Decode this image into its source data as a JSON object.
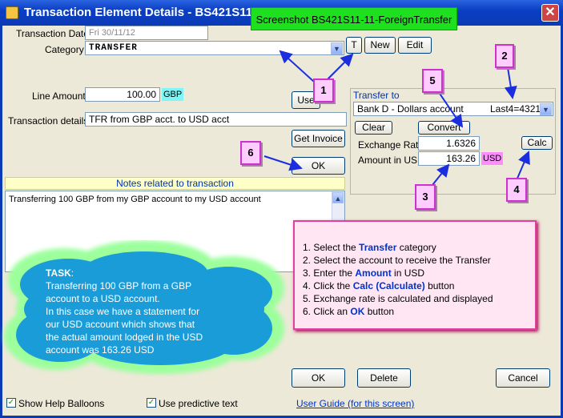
{
  "window": {
    "title": "Transaction Element Details - BS421S11",
    "close_glyph": "✕"
  },
  "screenshot_tag": "Screenshot BS421S11-11-ForeignTransfer",
  "form": {
    "transaction_date_label": "Transaction Date",
    "transaction_date_value": "Fri 30/11/12",
    "category_label": "Category",
    "category_value": "TRANSFER",
    "t_button": "T",
    "new_button": "New",
    "edit_button": "Edit",
    "line_amount_label": "Line Amount",
    "line_amount_value": "100.00",
    "line_amount_currency": "GBP",
    "use_button": "Use",
    "transaction_details_label": "Transaction details",
    "transaction_details_value": "TFR from GBP acct. to USD acct",
    "get_invoice_button": "Get Invoice",
    "ok_button_top": "OK"
  },
  "transfer_panel": {
    "title": "Transfer to",
    "account_value": "Bank D - Dollars account",
    "account_last4": "Last4=4321",
    "clear_button": "Clear",
    "convert_button": "Convert",
    "exchange_rate_label": "Exchange Rate",
    "exchange_rate_value": "1.6326",
    "amount_usd_label": "Amount in USD",
    "amount_usd_value": "163.26",
    "amount_usd_currency": "USD",
    "calc_button": "Calc"
  },
  "notes": {
    "header": "Notes related to transaction",
    "content": "Transferring 100 GBP from my GBP account to my USD account"
  },
  "callouts": [
    "1",
    "2",
    "3",
    "4",
    "5",
    "6"
  ],
  "instructions": [
    {
      "prefix": "1. Select the ",
      "kw": "Transfer",
      "suffix": " category"
    },
    {
      "prefix": "2. Select the account to receive the Transfer",
      "kw": "",
      "suffix": ""
    },
    {
      "prefix": "3. Enter the ",
      "kw": "Amount",
      "suffix": " in USD"
    },
    {
      "prefix": "4. Click the ",
      "kw": "Calc (Calculate)",
      "suffix": " button"
    },
    {
      "prefix": "5. Exchange rate is calculated and displayed",
      "kw": "",
      "suffix": ""
    },
    {
      "prefix": "6. Click an ",
      "kw": "OK",
      "suffix": " button"
    }
  ],
  "task": {
    "heading": "TASK",
    "lines": [
      "Transferring 100 GBP from a GBP",
      "account to a USD account.",
      "In this case we have a statement for",
      "our USD account which shows that",
      "the actual amount lodged in the USD",
      "account was 163.26 USD"
    ]
  },
  "bottom": {
    "ok_button": "OK",
    "delete_button": "Delete",
    "cancel_button": "Cancel",
    "show_help_label": "Show Help Balloons",
    "predictive_label": "Use predictive text",
    "user_guide_link": "User Guide (for this screen)",
    "check_glyph": "✓"
  },
  "colors": {
    "title_bar": "#0b3ab5",
    "callout_fill": "#ffccff",
    "callout_border": "#cc33cc",
    "arrow": "#1a2ee0",
    "task_cloud": "#1a9cd8",
    "cloud_glow": "#9cff9c"
  }
}
